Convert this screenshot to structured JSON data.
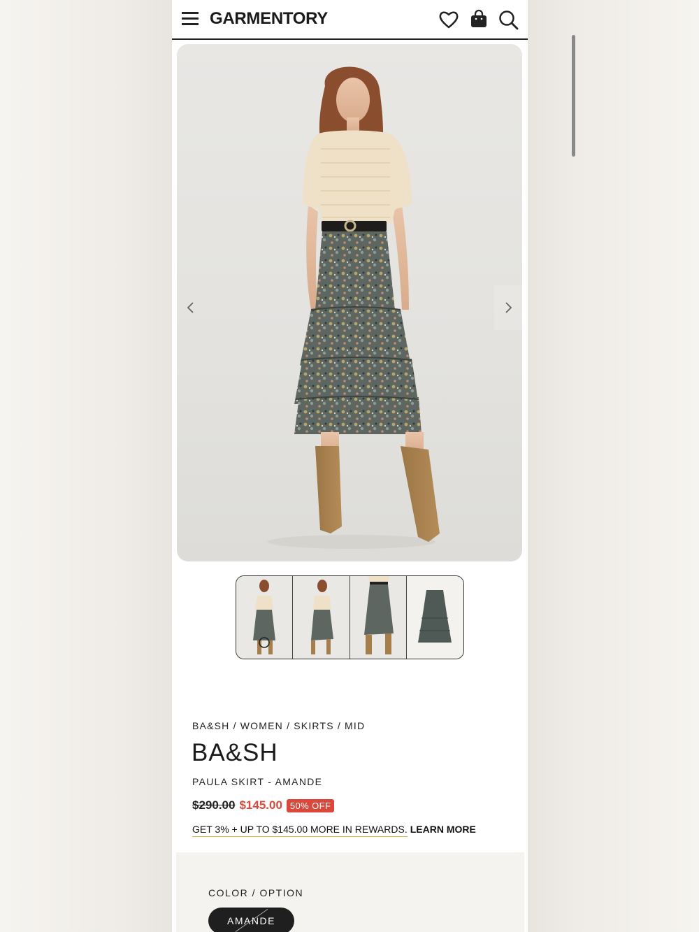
{
  "header": {
    "logo": "GARMENTORY",
    "icons": [
      "menu-icon",
      "heart-icon",
      "shopping-bag-icon",
      "search-icon"
    ]
  },
  "gallery": {
    "thumbnails": [
      "thumb-front-full",
      "thumb-front-walking",
      "thumb-skirt-detail",
      "thumb-skirt-flat"
    ]
  },
  "breadcrumb": [
    "BA&SH",
    "WOMEN",
    "SKIRTS",
    "MID"
  ],
  "breadcrumb_sep": "/",
  "product": {
    "brand": "BA&SH",
    "name": "PAULA SKIRT - AMANDE",
    "original_price": "$290.00",
    "sale_price": "$145.00",
    "discount_badge": "50% OFF",
    "rewards_text": "GET 3% + UP TO $145.00 MORE IN REWARDS.",
    "rewards_link": "LEARN MORE"
  },
  "options": {
    "label": "COLOR / OPTION",
    "selected": "AMANDE"
  },
  "colors": {
    "sale": "#d9483b",
    "rewards_underline": "#d6b64c"
  }
}
